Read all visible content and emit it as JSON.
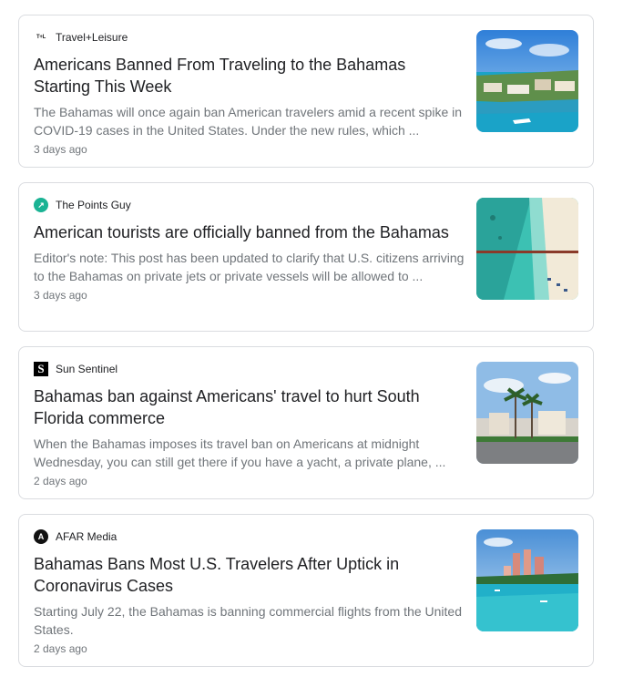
{
  "results": [
    {
      "source": "Travel+Leisure",
      "logo_text": "T+L",
      "headline": "Americans Banned From Traveling to the Bahamas Starting This Week",
      "snippet": "The Bahamas will once again ban American travelers amid a recent spike in COVID-19 cases in the United States. Under the new rules, which ...",
      "time": "3 days ago"
    },
    {
      "source": "The Points Guy",
      "logo_text": "↗",
      "headline": "American tourists are officially banned from the Bahamas",
      "snippet": "Editor's note: This post has been updated to clarify that U.S. citizens arriving to the Bahamas on private jets or private vessels will be allowed to ...",
      "time": "3 days ago"
    },
    {
      "source": "Sun Sentinel",
      "logo_text": "S",
      "headline": "Bahamas ban against Americans' travel to hurt South Florida commerce",
      "snippet": "When the Bahamas imposes its travel ban on Americans at midnight Wednesday, you can still get there if you have a yacht, a private plane, ...",
      "time": "2 days ago"
    },
    {
      "source": "AFAR Media",
      "logo_text": "A",
      "headline": "Bahamas Bans Most U.S. Travelers After Uptick in Coronavirus Cases",
      "snippet": "Starting July 22, the Bahamas is banning commercial flights from the United States.",
      "time": "2 days ago"
    }
  ],
  "icons": {
    "travel_leisure": "travel-leisure-logo-icon",
    "points_guy": "points-guy-logo-icon",
    "sun_sentinel": "sun-sentinel-logo-icon",
    "afar": "afar-logo-icon"
  },
  "colors": {
    "card_border": "#dadce0",
    "headline": "#202124",
    "snippet": "#70757a",
    "points_guy_brand": "#1ab394"
  }
}
